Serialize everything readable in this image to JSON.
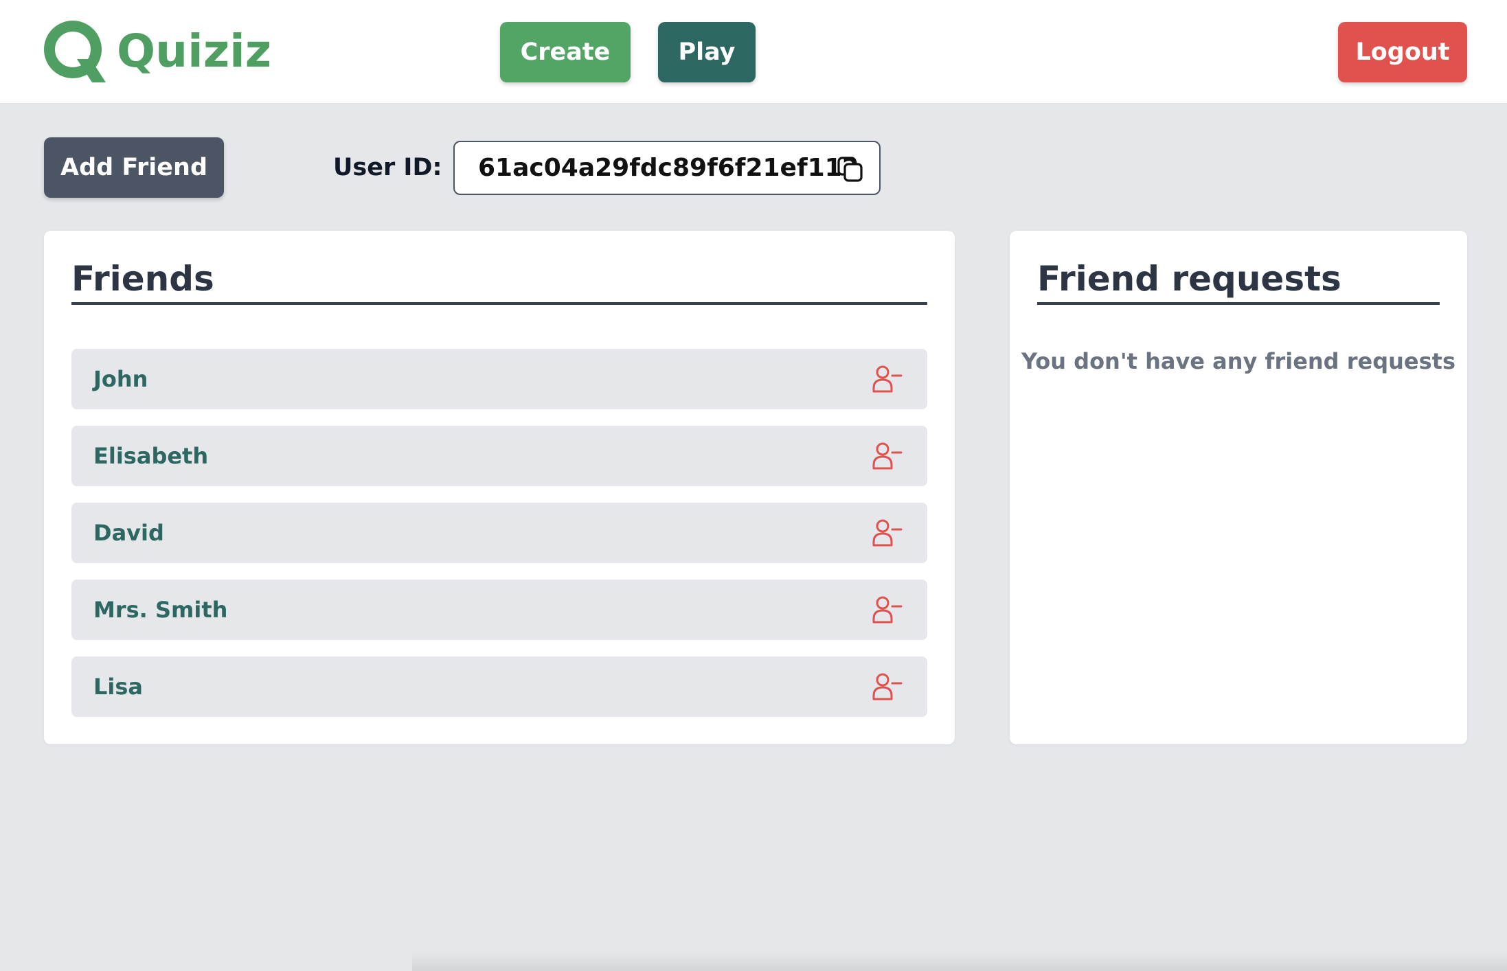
{
  "header": {
    "logo_text": "Quiziz",
    "create_label": "Create",
    "play_label": "Play",
    "logout_label": "Logout"
  },
  "toolbar": {
    "add_friend_label": "Add Friend",
    "user_id_label": "User ID:",
    "user_id_value": "61ac04a29fdc89f6f21ef112"
  },
  "friends": {
    "title": "Friends",
    "items": [
      {
        "name": "John"
      },
      {
        "name": "Elisabeth"
      },
      {
        "name": "David"
      },
      {
        "name": "Mrs. Smith"
      },
      {
        "name": "Lisa"
      }
    ]
  },
  "friend_requests": {
    "title": "Friend requests",
    "empty_message": "You don't have any friend requests"
  },
  "icons": {
    "logo": "quiziz-q-logo-icon",
    "copy": "copy-icon",
    "remove_friend": "user-minus-icon"
  },
  "colors": {
    "brand_green": "#4f9f63",
    "create_button": "#53a565",
    "play_button": "#2c6861",
    "logout_button": "#df524d",
    "add_friend_button": "#4b5563",
    "friend_name": "#2c6861",
    "remove_icon": "#df524d",
    "page_background": "#e5e7eb"
  }
}
